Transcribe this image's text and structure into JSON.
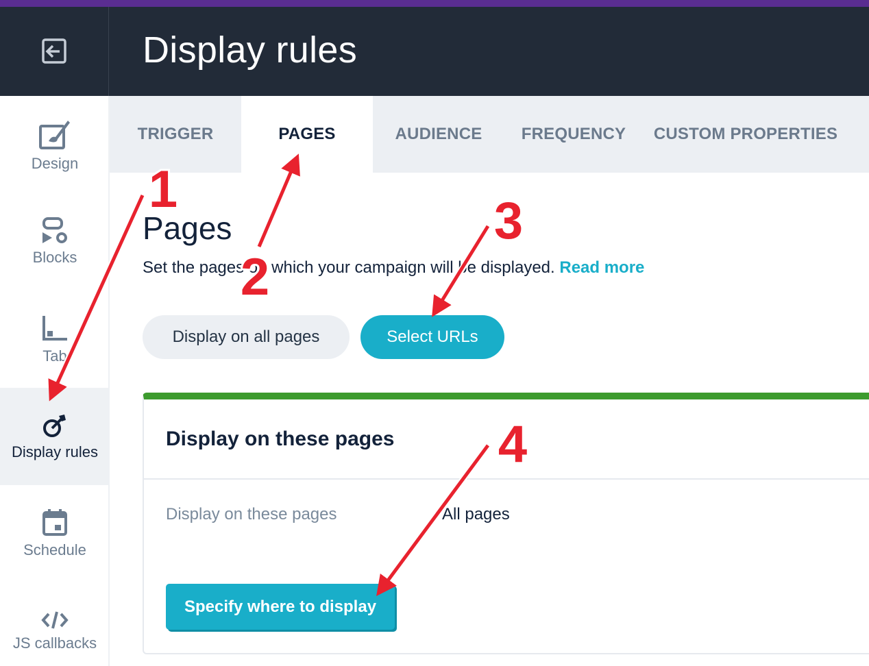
{
  "header": {
    "title": "Display rules"
  },
  "sidebar": {
    "items": [
      {
        "label": "Design",
        "icon": "design-brush-icon"
      },
      {
        "label": "Blocks",
        "icon": "blocks-icon"
      },
      {
        "label": "Tab",
        "icon": "tab-icon"
      },
      {
        "label": "Display rules",
        "icon": "target-dart-icon",
        "active": true
      },
      {
        "label": "Schedule",
        "icon": "calendar-icon"
      },
      {
        "label": "JS callbacks",
        "icon": "code-icon"
      }
    ]
  },
  "tabs": [
    {
      "label": "TRIGGER",
      "active": false
    },
    {
      "label": "PAGES",
      "active": true
    },
    {
      "label": "AUDIENCE",
      "active": false
    },
    {
      "label": "FREQUENCY",
      "active": false
    },
    {
      "label": "CUSTOM PROPERTIES",
      "active": false
    }
  ],
  "pages": {
    "title": "Pages",
    "description": "Set the pages on which your campaign will be displayed.",
    "read_more": "Read more",
    "option_all": "Display on all pages",
    "option_select": "Select URLs",
    "card": {
      "title": "Display on these pages",
      "row_label": "Display on these pages",
      "row_value": "All pages",
      "button": "Specify where to display"
    }
  },
  "annotations": {
    "numbers": [
      "1",
      "2",
      "3",
      "4"
    ],
    "color": "#e8222e"
  },
  "colors": {
    "accent": "#19aec9",
    "header_bg": "#222b38",
    "card_top": "#3d9b2e",
    "brand_stripe": "#5a2d91"
  }
}
